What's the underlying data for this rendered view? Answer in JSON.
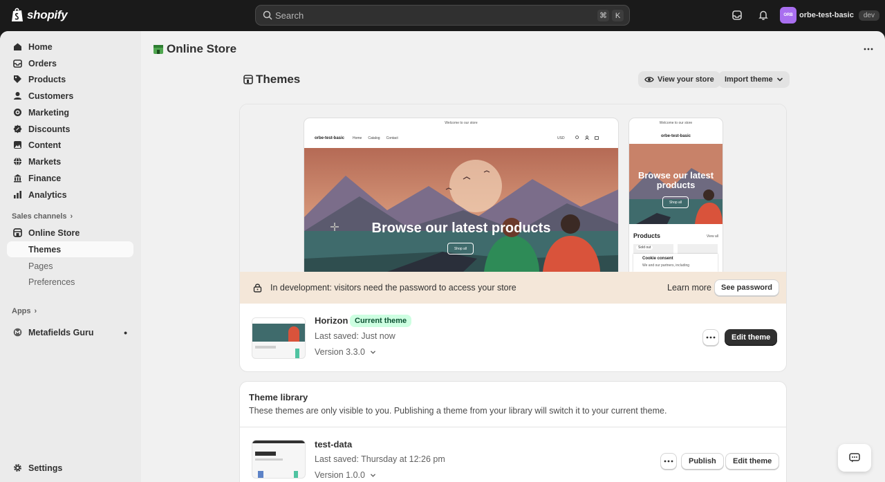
{
  "topbar": {
    "brand": "shopify",
    "search_placeholder": "Search",
    "shortcut_keys": [
      "⌘",
      "K"
    ],
    "store_avatar_text": "ORB",
    "store_name": "orbe-test-basic",
    "env_badge": "dev"
  },
  "sidebar": {
    "items": [
      {
        "label": "Home",
        "icon": "home-icon"
      },
      {
        "label": "Orders",
        "icon": "orders-icon"
      },
      {
        "label": "Products",
        "icon": "tag-icon"
      },
      {
        "label": "Customers",
        "icon": "person-icon"
      },
      {
        "label": "Marketing",
        "icon": "target-icon"
      },
      {
        "label": "Discounts",
        "icon": "discount-icon"
      },
      {
        "label": "Content",
        "icon": "image-icon"
      },
      {
        "label": "Markets",
        "icon": "globe-icon"
      },
      {
        "label": "Finance",
        "icon": "bank-icon"
      },
      {
        "label": "Analytics",
        "icon": "chart-icon"
      }
    ],
    "sales_channels_label": "Sales channels",
    "online_store_label": "Online Store",
    "sub_items": [
      "Themes",
      "Pages",
      "Preferences"
    ],
    "apps_label": "Apps",
    "app_item": "Metafields Guru",
    "settings_label": "Settings"
  },
  "main": {
    "page_title": "Online Store",
    "section_title": "Themes",
    "view_store_label": "View your store",
    "import_theme_label": "Import theme",
    "preview": {
      "announcement": "Welcome to our store",
      "store_name": "orbe-test-basic",
      "nav_links": [
        "Home",
        "Catalog",
        "Contact"
      ],
      "currency": "USD",
      "hero_text": "Browse our latest products",
      "mobile_hero_text": "Browse our latest products",
      "shop_all": "Shop all",
      "products_heading": "Products",
      "view_all": "View all",
      "sold_out": "Sold out",
      "cookie_title": "Cookie consent",
      "cookie_text": "We and our partners, including"
    },
    "dev_notice": "In development: visitors need the password to access your store",
    "learn_more": "Learn more",
    "see_password": "See password",
    "current_theme": {
      "name": "Horizon",
      "badge": "Current theme",
      "last_saved": "Last saved: Just now",
      "version": "Version 3.3.0",
      "edit_label": "Edit theme"
    },
    "library": {
      "title": "Theme library",
      "description": "These themes are only visible to you. Publishing a theme from your library will switch it to your current theme.",
      "themes": [
        {
          "name": "test-data",
          "last_saved": "Last saved: Thursday at 12:26 pm",
          "version": "Version 1.0.0",
          "publish_label": "Publish",
          "edit_label": "Edit theme"
        }
      ]
    }
  },
  "colors": {
    "topbar": "#1a1a1a",
    "canvas": "#f1f1f1",
    "sidebar": "#ebebeb",
    "badge_green_bg": "#cdfee1",
    "dev_bar": "#f4e7d9",
    "primary_button": "#303030"
  }
}
